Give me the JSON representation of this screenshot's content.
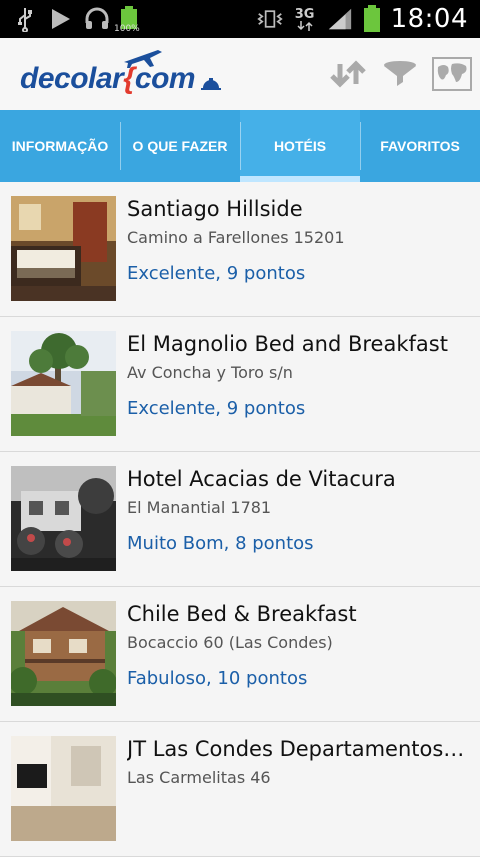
{
  "status_bar": {
    "time": "18:04",
    "network": "3G",
    "battery_percent": "100%"
  },
  "header": {
    "logo_left": "decolar",
    "logo_right": "com"
  },
  "tabs": [
    {
      "label": "INFORMAÇÃO"
    },
    {
      "label": "O QUE FAZER"
    },
    {
      "label": "HOTÉIS"
    },
    {
      "label": "FAVORITOS"
    }
  ],
  "hotels": [
    {
      "name": "Santiago Hillside",
      "address": "Camino a Farellones 15201",
      "rating": "Excelente, 9 pontos"
    },
    {
      "name": "El Magnolio Bed and Breakfast",
      "address": "Av Concha y Toro s/n",
      "rating": "Excelente, 9 pontos"
    },
    {
      "name": "Hotel Acacias de Vitacura",
      "address": "El Manantial 1781",
      "rating": "Muito Bom, 8 pontos"
    },
    {
      "name": "Chile Bed & Breakfast",
      "address": "Bocaccio 60 (Las Condes)",
      "rating": "Fabuloso, 10 pontos"
    },
    {
      "name": "JT Las Condes Departamentos…",
      "address": "Las Carmelitas 46",
      "rating": ""
    }
  ],
  "colors": {
    "tab_bar": "#3aa6e0",
    "rating_text": "#1b5fa8",
    "logo": "#1b4f9c",
    "logo_accent": "#e23b2e"
  }
}
